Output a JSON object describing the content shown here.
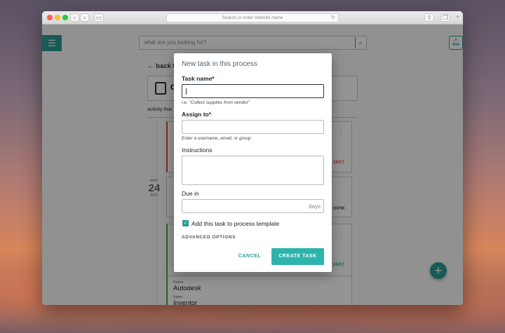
{
  "browser": {
    "url_placeholder": "Search or enter website name",
    "nav_back": "‹",
    "nav_forward": "›",
    "reload": "↻"
  },
  "app": {
    "menu_icon": "☰",
    "search_placeholder": "what are you looking for?",
    "bell_icon": "bell-icon",
    "back_label": "← back t",
    "process_card_initial": "C",
    "activity_label": "activity that"
  },
  "timeline": {
    "month": "MAY",
    "day": "24",
    "year": "2017",
    "card1_date": "19/17",
    "card2_date": "30PM",
    "card3_date": "24/17",
    "card4_owner_label": "Owner",
    "card4_owner_value": "Autodesk",
    "card4_name_label": "Name",
    "card4_name_value": "Inventor"
  },
  "modal": {
    "title": "New task in this process",
    "task_name_label": "Task name*",
    "task_name_value": "",
    "task_name_hint": "i.e. \"Collect supplies from vendor\"",
    "assign_label": "Assign to*",
    "assign_value": "",
    "assign_hint": "Enter a username, email, or group",
    "instructions_label": "Instructions",
    "instructions_value": "",
    "due_label": "Due in",
    "due_value": "",
    "due_unit": "days",
    "template_checkbox_label": "Add this task to process template",
    "template_checkbox_checked": true,
    "advanced_options": "ADVANCED OPTIONS",
    "cancel_button": "CANCEL",
    "create_button": "CREATE TASK"
  },
  "colors": {
    "accent": "#2b9c97",
    "primary_button": "#2fb3ad",
    "overdue": "#e04a3f",
    "done": "#3aaa52"
  }
}
